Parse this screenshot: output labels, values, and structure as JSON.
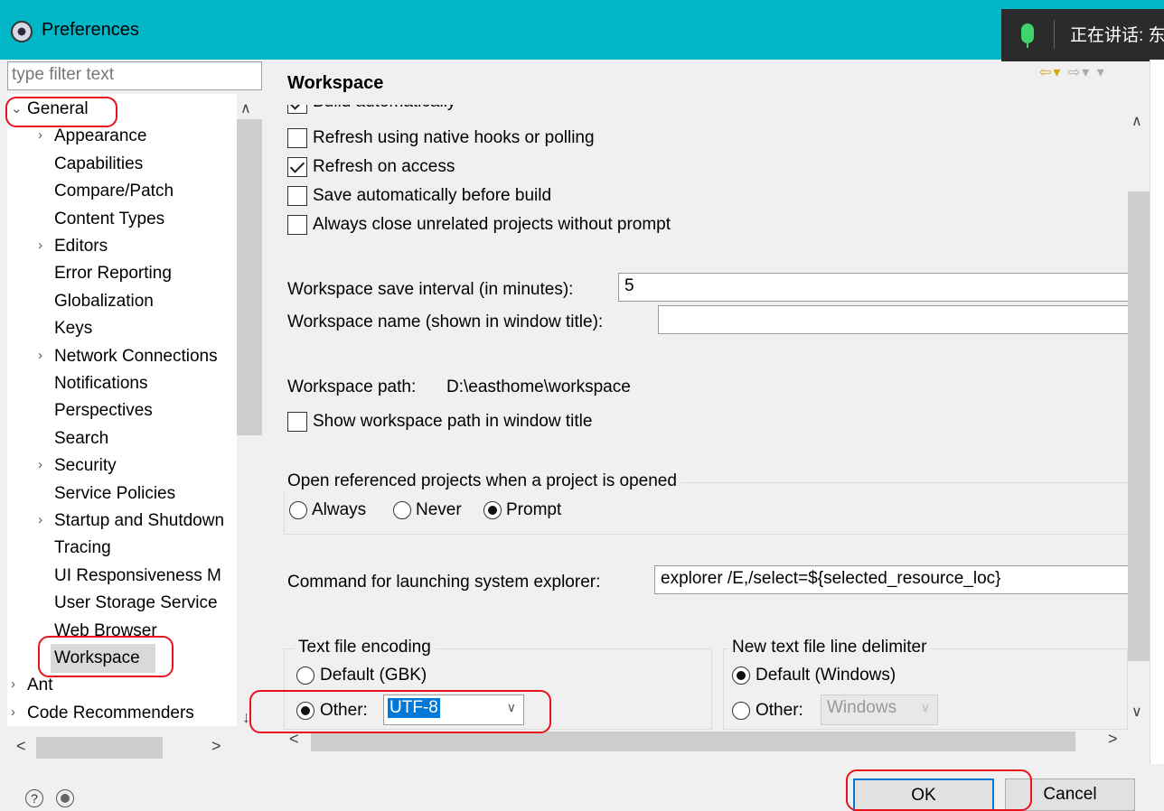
{
  "window": {
    "title": "Preferences"
  },
  "overlay": {
    "speaking_text": "正在讲话: 东"
  },
  "filter": {
    "placeholder": "type filter text"
  },
  "tree": {
    "items": [
      {
        "label": "General",
        "expanded": true,
        "level": 0
      },
      {
        "label": "Appearance",
        "level": 1,
        "has_children": true
      },
      {
        "label": "Capabilities",
        "level": 1
      },
      {
        "label": "Compare/Patch",
        "level": 1
      },
      {
        "label": "Content Types",
        "level": 1
      },
      {
        "label": "Editors",
        "level": 1,
        "has_children": true
      },
      {
        "label": "Error Reporting",
        "level": 1
      },
      {
        "label": "Globalization",
        "level": 1
      },
      {
        "label": "Keys",
        "level": 1
      },
      {
        "label": "Network Connections",
        "level": 1,
        "has_children": true
      },
      {
        "label": "Notifications",
        "level": 1
      },
      {
        "label": "Perspectives",
        "level": 1
      },
      {
        "label": "Search",
        "level": 1
      },
      {
        "label": "Security",
        "level": 1,
        "has_children": true
      },
      {
        "label": "Service Policies",
        "level": 1
      },
      {
        "label": "Startup and Shutdown",
        "level": 1,
        "has_children": true
      },
      {
        "label": "Tracing",
        "level": 1
      },
      {
        "label": "UI Responsiveness M",
        "level": 1
      },
      {
        "label": "User Storage Service",
        "level": 1
      },
      {
        "label": "Web Browser",
        "level": 1
      },
      {
        "label": "Workspace",
        "level": 1,
        "selected": true
      },
      {
        "label": "Ant",
        "level": 0,
        "has_children": true
      },
      {
        "label": "Code Recommenders",
        "level": 0,
        "has_children": true
      }
    ]
  },
  "page": {
    "title": "Workspace",
    "partial_top_label": "Build automatically",
    "options": {
      "refresh_native": {
        "label": "Refresh using native hooks or polling",
        "checked": false
      },
      "refresh_access": {
        "label": "Refresh on access",
        "checked": true
      },
      "save_before_build": {
        "label": "Save automatically before build",
        "checked": false
      },
      "close_unrelated": {
        "label": "Always close unrelated projects without prompt",
        "checked": false
      }
    },
    "save_interval": {
      "label": "Workspace save interval (in minutes):",
      "value": "5"
    },
    "workspace_name": {
      "label": "Workspace name (shown in window title):",
      "value": ""
    },
    "workspace_path": {
      "label": "Workspace path:",
      "value": "D:\\easthome\\workspace"
    },
    "show_path": {
      "label": "Show workspace path in window title",
      "checked": false
    },
    "open_referenced": {
      "label": "Open referenced projects when a project is opened",
      "choices": [
        "Always",
        "Never",
        "Prompt"
      ],
      "selected": "Prompt"
    },
    "explorer_cmd": {
      "label": "Command for launching system explorer:",
      "value": "explorer /E,/select=${selected_resource_loc}"
    },
    "encoding": {
      "label": "Text file encoding",
      "default_label": "Default (GBK)",
      "other_label": "Other:",
      "other_value": "UTF-8",
      "selected": "Other"
    },
    "line_delimiter": {
      "label": "New text file line delimiter",
      "default_label": "Default (Windows)",
      "other_label": "Other:",
      "other_value": "Windows",
      "selected": "Default"
    }
  },
  "buttons": {
    "ok": "OK",
    "cancel": "Cancel"
  },
  "colors": {
    "titlebar": "#00b6c7",
    "annotation": "#e8121d",
    "selection": "#0078d7"
  }
}
